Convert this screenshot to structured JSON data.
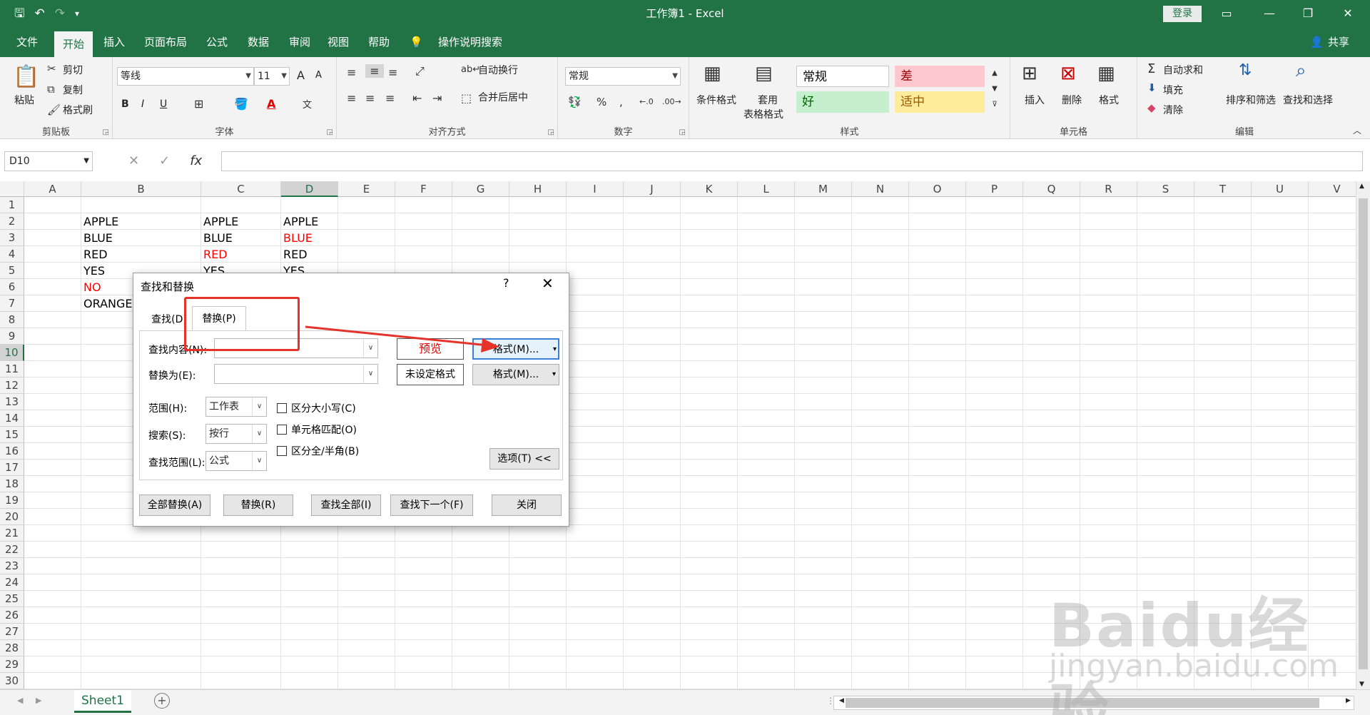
{
  "window": {
    "title": "工作簿1  -  Excel",
    "login": "登录",
    "share": "共享"
  },
  "tabs": [
    "文件",
    "开始",
    "插入",
    "页面布局",
    "公式",
    "数据",
    "审阅",
    "视图",
    "帮助",
    "操作说明搜索"
  ],
  "ribbon": {
    "clipboard": {
      "paste": "粘贴",
      "cut": "剪切",
      "copy": "复制",
      "format_painter": "格式刷",
      "label": "剪贴板"
    },
    "font": {
      "font_name": "等线",
      "font_size": "11",
      "label": "字体",
      "bold": "B",
      "italic": "I",
      "underline": "U",
      "grow": "A",
      "shrink": "A"
    },
    "alignment": {
      "wrap": "自动换行",
      "merge": "合并后居中",
      "label": "对齐方式"
    },
    "number": {
      "format": "常规",
      "label": "数字"
    },
    "styles": {
      "conditional": "条件格式",
      "table_format_1": "套用",
      "table_format_2": "表格格式",
      "normal": "常规",
      "bad": "差",
      "good": "好",
      "neutral": "适中",
      "label": "样式"
    },
    "cells": {
      "insert": "插入",
      "delete": "删除",
      "format": "格式",
      "label": "单元格"
    },
    "editing": {
      "autosum": "自动求和",
      "fill": "填充",
      "clear": "清除",
      "sort": "排序和筛选",
      "find": "查找和选择",
      "label": "编辑"
    }
  },
  "formula_bar": {
    "name_box": "D10",
    "fx": "fx"
  },
  "grid": {
    "columns": [
      "A",
      "B",
      "C",
      "D",
      "E",
      "F",
      "G",
      "H",
      "I",
      "J",
      "K",
      "L",
      "M",
      "N",
      "O",
      "P",
      "Q",
      "R",
      "S",
      "T",
      "U",
      "V"
    ],
    "rows": [
      "1",
      "2",
      "3",
      "4",
      "5",
      "6",
      "7",
      "8",
      "9",
      "10",
      "11",
      "12",
      "13",
      "14",
      "15",
      "16",
      "17",
      "18",
      "19",
      "20",
      "21",
      "22",
      "23",
      "24",
      "25",
      "26",
      "27",
      "28",
      "29",
      "30"
    ],
    "cells": {
      "B2": "APPLE",
      "C2": "APPLE",
      "D2": "APPLE",
      "B3": "BLUE",
      "C3": "BLUE",
      "D3": "BLUE",
      "B4": "RED",
      "C4": "RED",
      "D4": "RED",
      "B5": "YES",
      "C5": "YES",
      "D5": "YES",
      "B6": "NO",
      "B7": "ORANGE"
    },
    "red_color": "#ff0000"
  },
  "sheet": {
    "tab": "Sheet1",
    "add": "+"
  },
  "dialog": {
    "title": "查找和替换",
    "help": "?",
    "close": "✕",
    "tab_find": "查找(D)",
    "tab_replace": "替换(P)",
    "find_label": "查找内容(N):",
    "replace_label": "替换为(E):",
    "preview": "预览",
    "preview_unset": "未设定格式",
    "format_button": "格式(M)...",
    "within_label": "范围(H):",
    "within_value": "工作表",
    "search_label": "搜索(S):",
    "search_value": "按行",
    "lookin_label": "查找范围(L):",
    "lookin_value": "公式",
    "match_case": "区分大小写(C)",
    "match_cell": "单元格匹配(O)",
    "match_byte": "区分全/半角(B)",
    "options_button": "选项(T) <<",
    "replace_all": "全部替换(A)",
    "replace": "替换(R)",
    "find_all": "查找全部(I)",
    "find_next": "查找下一个(F)",
    "close_button": "关闭"
  },
  "watermark": {
    "main": "Baidu经验",
    "sub": "jingyan.baidu.com"
  },
  "colors": {
    "excel_green": "#217346",
    "annotation_red": "#e5332a"
  }
}
